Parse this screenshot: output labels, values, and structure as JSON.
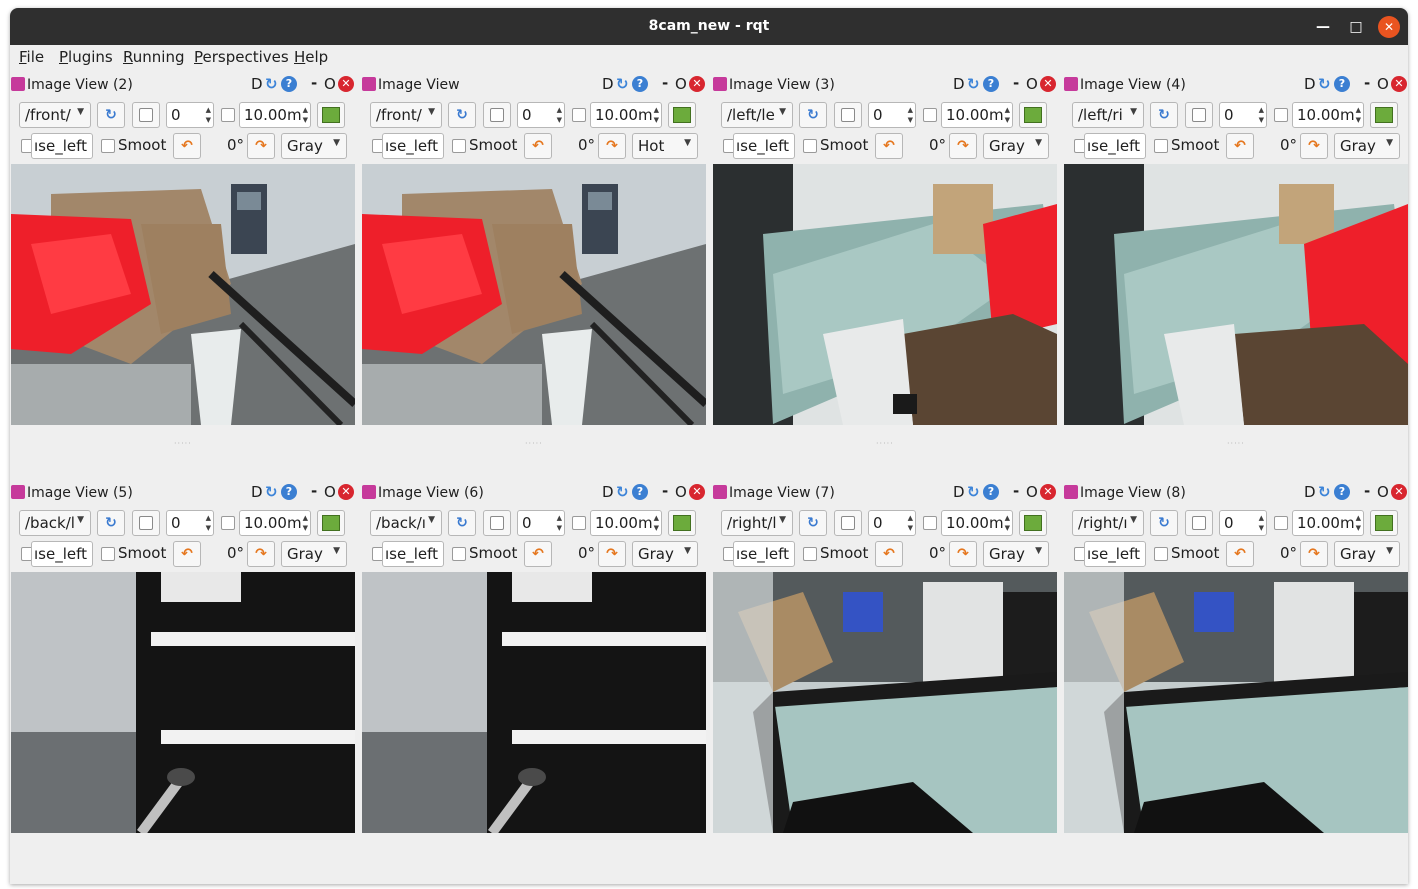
{
  "window": {
    "title": "8cam_new - rqt",
    "controls": [
      "minimize-icon",
      "maximize-icon",
      "close-icon"
    ]
  },
  "menu": [
    "File",
    "Plugins",
    "Running",
    "Perspectives",
    "Help"
  ],
  "toolbar_glyphs": {
    "d": "D",
    "dash": "-",
    "o": "O",
    "smooth_label": "Smoot"
  },
  "panels": [
    {
      "title": "Image View (2)",
      "topic": "/front/",
      "value": "0",
      "max": "10.00m",
      "transport": "ıse_left",
      "rotation": "0°",
      "colormap": "Gray",
      "scene": "front-desk-red"
    },
    {
      "title": "Image View",
      "topic": "/front/",
      "value": "0",
      "max": "10.00m",
      "transport": "ıse_left",
      "rotation": "0°",
      "colormap": "Hot",
      "scene": "front-desk-red"
    },
    {
      "title": "Image View (3)",
      "topic": "/left/le",
      "value": "0",
      "max": "10.00m",
      "transport": "ıse_left",
      "rotation": "0°",
      "colormap": "Gray",
      "scene": "left-glass"
    },
    {
      "title": "Image View (4)",
      "topic": "/left/ri",
      "value": "0",
      "max": "10.00m",
      "transport": "ıse_left",
      "rotation": "0°",
      "colormap": "Gray",
      "scene": "left-glass-red"
    },
    {
      "title": "Image View (5)",
      "topic": "/back/l",
      "value": "0",
      "max": "10.00m",
      "transport": "ıse_left",
      "rotation": "0°",
      "colormap": "Gray",
      "scene": "back-ceiling"
    },
    {
      "title": "Image View (6)",
      "topic": "/back/ı",
      "value": "0",
      "max": "10.00m",
      "transport": "ıse_left",
      "rotation": "0°",
      "colormap": "Gray",
      "scene": "back-ceiling"
    },
    {
      "title": "Image View (7)",
      "topic": "/right/l",
      "value": "0",
      "max": "10.00m",
      "transport": "ıse_left",
      "rotation": "0°",
      "colormap": "Gray",
      "scene": "right-room"
    },
    {
      "title": "Image View (8)",
      "topic": "/right/ı",
      "value": "0",
      "max": "10.00m",
      "transport": "ıse_left",
      "rotation": "0°",
      "colormap": "Gray",
      "scene": "right-room"
    }
  ]
}
